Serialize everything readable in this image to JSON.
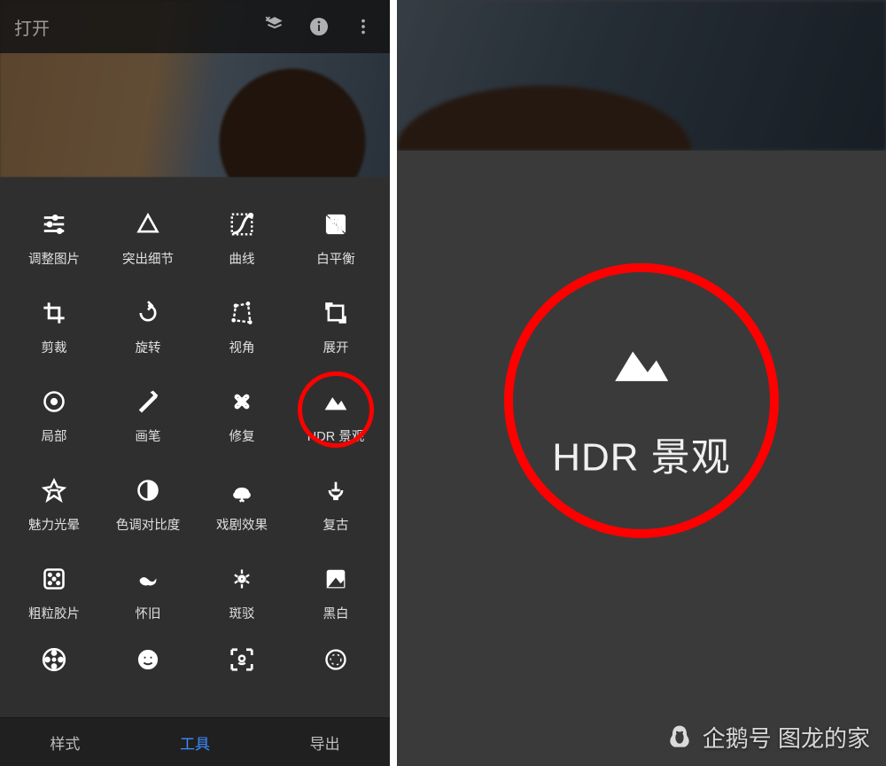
{
  "topbar": {
    "open_label": "打开",
    "icons": {
      "layers": "layers-icon",
      "info": "info-icon",
      "more": "more-icon"
    }
  },
  "tools": {
    "rows": [
      [
        {
          "name": "tune",
          "label": "调整图片"
        },
        {
          "name": "details",
          "label": "突出细节"
        },
        {
          "name": "curves",
          "label": "曲线"
        },
        {
          "name": "whitebalance",
          "label": "白平衡"
        }
      ],
      [
        {
          "name": "crop",
          "label": "剪裁"
        },
        {
          "name": "rotate",
          "label": "旋转"
        },
        {
          "name": "perspective",
          "label": "视角"
        },
        {
          "name": "expand",
          "label": "展开"
        }
      ],
      [
        {
          "name": "selective",
          "label": "局部"
        },
        {
          "name": "brush",
          "label": "画笔"
        },
        {
          "name": "healing",
          "label": "修复"
        },
        {
          "name": "hdr",
          "label": "HDR 景观",
          "highlight": true
        }
      ],
      [
        {
          "name": "glamour",
          "label": "魅力光晕"
        },
        {
          "name": "tonal",
          "label": "色调对比度"
        },
        {
          "name": "drama",
          "label": "戏剧效果"
        },
        {
          "name": "vintage",
          "label": "复古"
        }
      ],
      [
        {
          "name": "grainy",
          "label": "粗粒胶片"
        },
        {
          "name": "retrolux",
          "label": "怀旧"
        },
        {
          "name": "grunge",
          "label": "斑驳"
        },
        {
          "name": "bw",
          "label": "黑白"
        }
      ],
      [
        {
          "name": "film",
          "label": ""
        },
        {
          "name": "face",
          "label": ""
        },
        {
          "name": "portrait",
          "label": ""
        },
        {
          "name": "lens",
          "label": ""
        }
      ]
    ]
  },
  "bottomnav": {
    "styles": "样式",
    "tools": "工具",
    "export": "导出",
    "active": "tools"
  },
  "right_detail": {
    "label": "HDR 景观"
  },
  "watermark": {
    "text": "企鹅号 图龙的家"
  },
  "colors": {
    "highlight_circle": "#ff0000",
    "active_tab": "#3a8eff"
  }
}
